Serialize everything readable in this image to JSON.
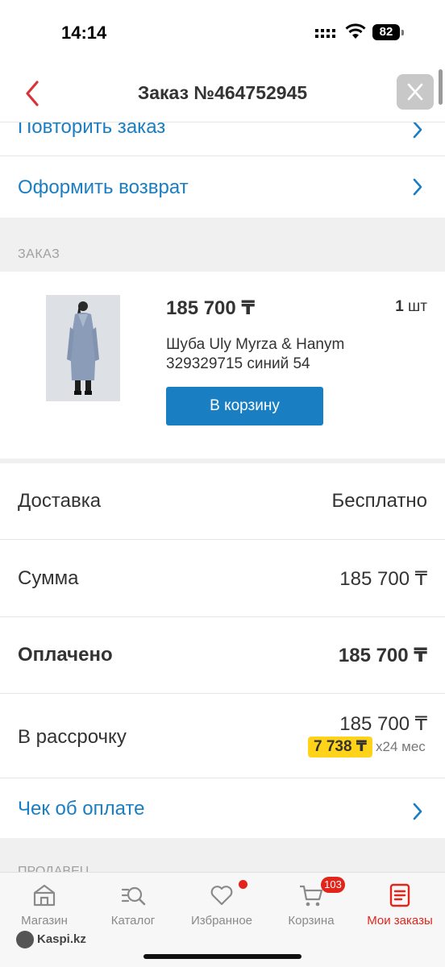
{
  "status_bar": {
    "time": "14:14",
    "battery": "82"
  },
  "header": {
    "title": "Заказ №464752945"
  },
  "actions": {
    "repeat_order": "Повторить заказ",
    "return": "Оформить возврат"
  },
  "order_section": {
    "label": "ЗАКАЗ",
    "product": {
      "price": "185 700 ₸",
      "quantity": "1",
      "quantity_unit": "шт",
      "name": "Шуба Uly Myrza & Hanym 329329715 синий 54",
      "cart_button": "В корзину"
    }
  },
  "summary": {
    "delivery_label": "Доставка",
    "delivery_value": "Бесплатно",
    "sum_label": "Сумма",
    "sum_value": "185 700 ₸",
    "paid_label": "Оплачено",
    "paid_value": "185 700 ₸",
    "installment_label": "В рассрочку",
    "installment_total": "185 700 ₸",
    "installment_monthly": "7 738 ₸",
    "installment_term": "х24 мес"
  },
  "receipt": {
    "label": "Чек об оплате"
  },
  "sellers_label": "ПРОДАВЕЦ",
  "bottom_nav": {
    "items": [
      {
        "label": "Магазин",
        "icon": "shop-icon"
      },
      {
        "label": "Каталог",
        "icon": "catalog-search-icon"
      },
      {
        "label": "Избранное",
        "icon": "heart-icon"
      },
      {
        "label": "Корзина",
        "icon": "cart-icon",
        "badge": "103"
      },
      {
        "label": "Мои заказы",
        "icon": "orders-icon"
      }
    ],
    "brand": "Kaspi.kz"
  },
  "colors": {
    "accent_blue": "#1a7ec2",
    "accent_red": "#e2241a",
    "badge_yellow": "#ffd31a"
  }
}
